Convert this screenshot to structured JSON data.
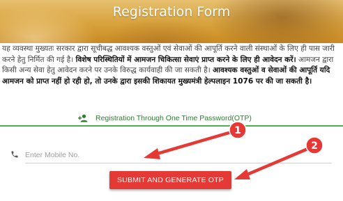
{
  "header": {
    "title": "Registration Form"
  },
  "notice": {
    "part1": "यह व्यवस्था मुख्यतः सरकार द्वारा सूचीबद्ध आवश्यक वस्तुओं एवं सेवाओं की आपूर्ति करने वाली संस्थाओं के लिए ही पास जारी करने हेतु निर्मित की गई है। ",
    "part2_bold": "विशेष परिस्थितियों में आमजन चिकित्सा सेवाएं प्राप्त करने के लिए ही आवेदन करें।",
    "part3": " आमजन द्वारा किसी अन्य सेवा हेतु आवेदन करने पर उनके विरुद्ध कार्यवाही की जा सकती है। ",
    "part4_bold": "आवश्यक वस्तुओं व सेवाओं की आपूर्ति यदि आमजन को प्राप्त नहीं हो रही हो, तो उनके द्वारा इसकी शिकायत मुख्यमंत्री हेल्पलाइन 1076 पर की जा सकती है।"
  },
  "otp_section": {
    "label": "Registration Through One Time Password(OTP)",
    "icon": "add-user-icon"
  },
  "form": {
    "mobile": {
      "placeholder": "Enter Mobile No.",
      "value": "",
      "icon": "phone-icon"
    },
    "submit_label": "SUBMIT AND GENERATE OTP"
  },
  "annotations": {
    "badges": [
      {
        "number": "1"
      },
      {
        "number": "2"
      }
    ],
    "color": "#e53935"
  },
  "colors": {
    "header": "#d8a23c",
    "accent_green": "#4caf50",
    "button_red": "#e53935"
  }
}
